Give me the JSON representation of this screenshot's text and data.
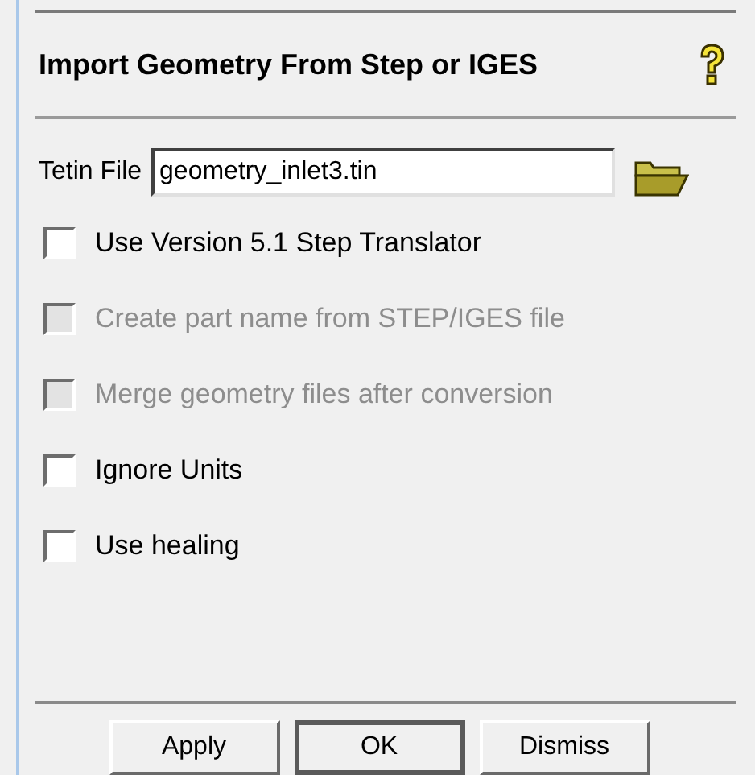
{
  "title": "Import Geometry From Step or IGES",
  "tetin_file": {
    "label": "Tetin File",
    "value": "geometry_inlet3.tin"
  },
  "options": [
    {
      "label": "Use Version 5.1 Step Translator",
      "checked": false,
      "disabled": false
    },
    {
      "label": "Create part name from STEP/IGES file",
      "checked": false,
      "disabled": true
    },
    {
      "label": "Merge geometry files after conversion",
      "checked": false,
      "disabled": true
    },
    {
      "label": "Ignore Units",
      "checked": false,
      "disabled": false
    },
    {
      "label": "Use healing",
      "checked": false,
      "disabled": false
    }
  ],
  "buttons": [
    {
      "label": "Apply",
      "default": false
    },
    {
      "label": "OK",
      "default": true
    },
    {
      "label": "Dismiss",
      "default": false
    }
  ]
}
